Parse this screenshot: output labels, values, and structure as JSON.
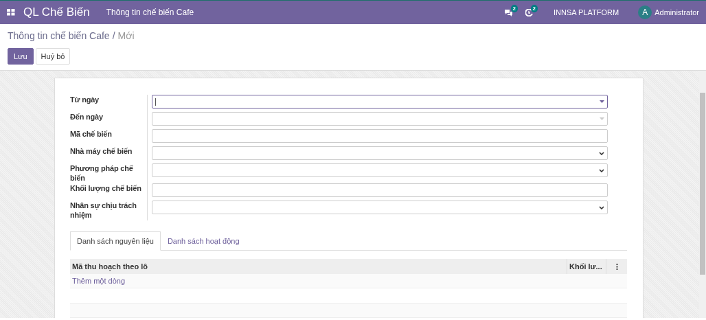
{
  "navbar": {
    "app_title": "QL Chế Biến",
    "menu": "Thông tin chế biến Cafe",
    "messages_badge": "2",
    "activity_badge": "2",
    "company": "INNSA PLATFORM",
    "avatar_letter": "A",
    "user": "Administrator"
  },
  "breadcrumb": {
    "parent": "Thông tin chế biến Cafe",
    "separator": "/",
    "current": "Mới"
  },
  "buttons": [
    {
      "label": "Lưu",
      "kind": "primary"
    },
    {
      "label": "Huỷ bỏ",
      "kind": "secondary"
    }
  ],
  "fields": [
    {
      "label": "Từ ngày",
      "kind": "date",
      "focused": true
    },
    {
      "label": "Đến ngày",
      "kind": "date",
      "focused": false
    },
    {
      "label": "Mã chế biến",
      "kind": "text",
      "focused": false
    },
    {
      "label": "Nhà máy chế biến",
      "kind": "select",
      "focused": false
    },
    {
      "label": "Phương pháp chế biến",
      "kind": "select",
      "focused": false
    },
    {
      "label": "Khối lượng chế biến",
      "kind": "text",
      "focused": false
    },
    {
      "label": "Nhân sự chịu trách nhiệm",
      "kind": "select",
      "focused": false
    }
  ],
  "tabs": [
    {
      "label": "Danh sách nguyên liệu",
      "selected": true
    },
    {
      "label": "Danh sách hoạt động",
      "selected": false
    }
  ],
  "table": {
    "columns": [
      "Mã thu hoạch theo lô",
      "Khối lư..."
    ],
    "add_line": "Thêm một dòng"
  }
}
